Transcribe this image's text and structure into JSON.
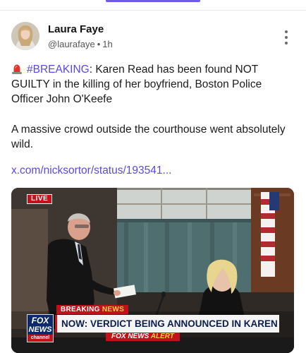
{
  "post": {
    "author_name": "Laura Faye",
    "handle": "@laurafaye",
    "separator": "•",
    "timestamp": "1h",
    "hashtag": "#BREAKING",
    "text_after_hashtag": ": Karen Read has been found NOT GUILTY in the killing of her boyfriend, Boston Police Officer John O'Keefe",
    "paragraph2": "A massive crowd outside the courthouse went absolutely wild.",
    "link": "x.com/nicksortor/status/193541..."
  },
  "media": {
    "live_label": "LIVE",
    "breaking_word": "BREAKING",
    "breaking_accent": "NEWS",
    "fox_logo_line1": "FOX",
    "fox_logo_line2": "NEWS",
    "fox_logo_line3": "channel",
    "headline": "NOW: VERDICT BEING ANNOUNCED IN KAREN READ TRIAL",
    "alert_prefix": "FOX NEWS",
    "alert_accent": "ALERT"
  },
  "icons": {
    "siren": "siren-icon",
    "more": "more-vertical-icon"
  },
  "colors": {
    "accent": "#5b49e0",
    "tab_indicator": "#6c5ce7",
    "fox_red": "#c4121a",
    "fox_blue": "#0b2a6b"
  }
}
